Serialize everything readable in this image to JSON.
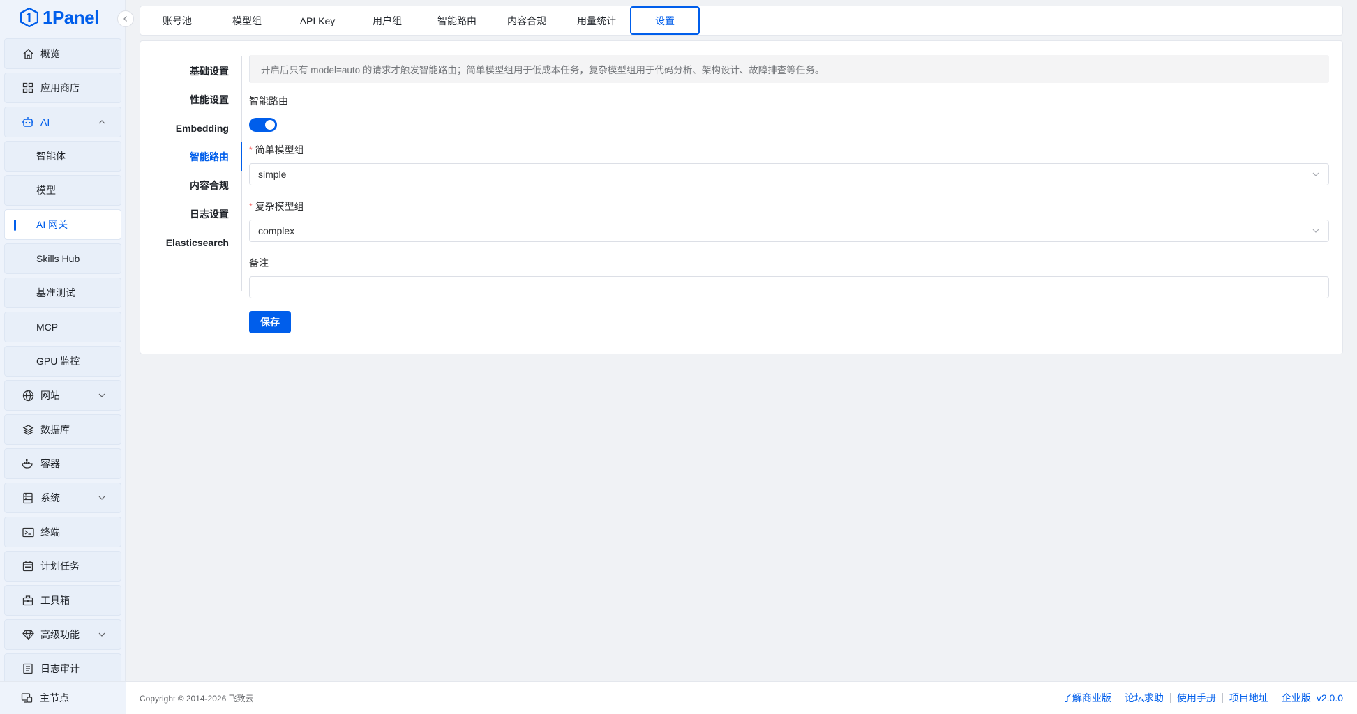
{
  "brand": {
    "name": "1Panel",
    "color": "#005eeb"
  },
  "sidebar": {
    "items": [
      {
        "label": "概览",
        "icon": "home-icon"
      },
      {
        "label": "应用商店",
        "icon": "grid-icon"
      },
      {
        "label": "AI",
        "icon": "robot-icon",
        "expanded": true
      },
      {
        "label": "智能体",
        "sub": true
      },
      {
        "label": "模型",
        "sub": true
      },
      {
        "label": "AI 网关",
        "sub": true,
        "active": true
      },
      {
        "label": "Skills Hub",
        "sub": true
      },
      {
        "label": "基准测试",
        "sub": true
      },
      {
        "label": "MCP",
        "sub": true
      },
      {
        "label": "GPU 监控",
        "sub": true
      },
      {
        "label": "网站",
        "icon": "globe-icon",
        "collapsible": true
      },
      {
        "label": "数据库",
        "icon": "layers-icon"
      },
      {
        "label": "容器",
        "icon": "docker-icon"
      },
      {
        "label": "系统",
        "icon": "server-icon",
        "collapsible": true
      },
      {
        "label": "终端",
        "icon": "terminal-icon"
      },
      {
        "label": "计划任务",
        "icon": "calendar-icon"
      },
      {
        "label": "工具箱",
        "icon": "toolbox-icon"
      },
      {
        "label": "高级功能",
        "icon": "diamond-icon",
        "collapsible": true
      },
      {
        "label": "日志审计",
        "icon": "log-icon"
      }
    ],
    "bottom": {
      "label": "主节点",
      "icon": "nodes-icon"
    }
  },
  "tabs": [
    {
      "label": "账号池"
    },
    {
      "label": "模型组"
    },
    {
      "label": "API Key"
    },
    {
      "label": "用户组"
    },
    {
      "label": "智能路由"
    },
    {
      "label": "内容合规"
    },
    {
      "label": "用量统计"
    },
    {
      "label": "设置",
      "active": true
    }
  ],
  "settings_nav": [
    {
      "label": "基础设置"
    },
    {
      "label": "性能设置"
    },
    {
      "label": "Embedding"
    },
    {
      "label": "智能路由",
      "active": true
    },
    {
      "label": "内容合规"
    },
    {
      "label": "日志设置"
    },
    {
      "label": "Elasticsearch"
    }
  ],
  "form": {
    "notice": "开启后只有 model=auto 的请求才触发智能路由；简单模型组用于低成本任务，复杂模型组用于代码分析、架构设计、故障排查等任务。",
    "routing_label": "智能路由",
    "routing_enabled": true,
    "simple_group_label": "简单模型组",
    "simple_group_value": "simple",
    "complex_group_label": "复杂模型组",
    "complex_group_value": "complex",
    "remark_label": "备注",
    "remark_value": "",
    "save_label": "保存"
  },
  "footer": {
    "copyright": "Copyright © 2014-2026 飞致云",
    "links": [
      "了解商业版",
      "论坛求助",
      "使用手册",
      "项目地址",
      "企业版"
    ],
    "version": "v2.0.0"
  }
}
